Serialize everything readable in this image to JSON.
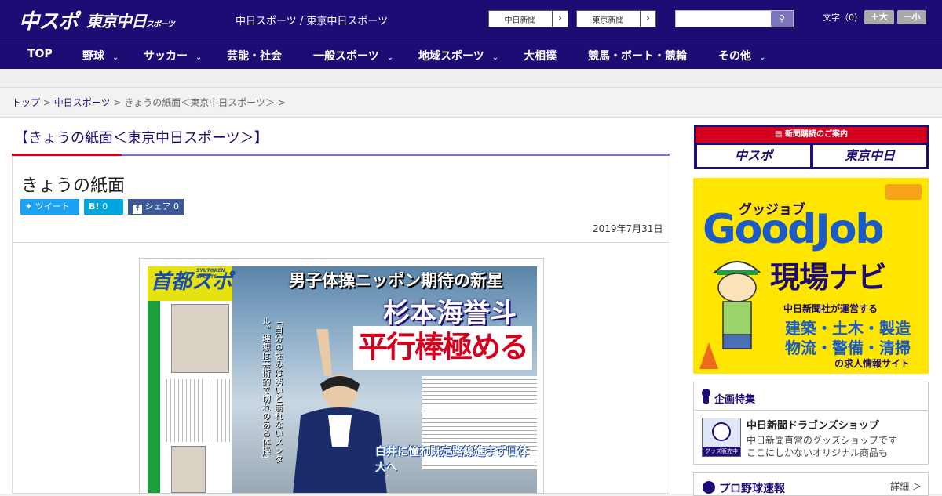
{
  "header": {
    "logo_chuspo": "中スポ",
    "logo_tokyo": "東京中日",
    "logo_tokyo_small": "スポーツ",
    "site_name": "中日スポーツ / 東京中日スポーツ",
    "newspaper_links": [
      {
        "label": "中日新聞"
      },
      {
        "label": "東京新聞"
      }
    ],
    "search": {
      "value": "",
      "placeholder": ""
    },
    "font_size": {
      "label": "文字（0）",
      "bigger": "＋大",
      "smaller": "－小"
    }
  },
  "nav": [
    {
      "label": "TOP"
    },
    {
      "label": "野球",
      "dropdown": true
    },
    {
      "label": "サッカー",
      "dropdown": true
    },
    {
      "label": "芸能・社会"
    },
    {
      "label": "一般スポーツ",
      "dropdown": true
    },
    {
      "label": "地域スポーツ",
      "dropdown": true
    },
    {
      "label": "大相撲"
    },
    {
      "label": "競馬・ボート・競輪"
    },
    {
      "label": "その他",
      "dropdown": true
    }
  ],
  "breadcrumb": {
    "top": "トップ",
    "chunichi": "中日スポーツ",
    "current": "きょうの紙面＜東京中日スポーツ＞",
    "sep": ">"
  },
  "section_heading": "【きょうの紙面＜東京中日スポーツ＞】",
  "page_title": "きょうの紙面",
  "share": {
    "tweet": "ツイート",
    "hatena": "B!",
    "hatena_count": "0",
    "facebook": "シェア",
    "facebook_count": "0"
  },
  "date": "2019年7月31日",
  "paper": {
    "brand": "首都スポ",
    "brand_sub": "SYUTOKEN SPORTS",
    "headline": "男子体操ニッポン期待の新星",
    "name": "杉本海誉斗",
    "banner": "平行棒極める",
    "quote": "「自分の強みは勢いと崩れないメンタル。理想は芸術的で切れのある体操」",
    "caption": "白井に憧れ既定路線進まず日体大へ"
  },
  "sidebar": {
    "subscribe_title": "新聞購読のご案内",
    "subscribe_chuspo": "中スポ",
    "subscribe_tokyo": "東京中日",
    "goodjob": {
      "top": "グッジョブ",
      "big": "GoodJob",
      "navi": "現場ナビ",
      "operator": "中日新聞社が運営する",
      "line1": "建築・土木・製造",
      "line2": "物流・警備・清掃",
      "site": "の求人情報サイト"
    },
    "feature": {
      "heading": "企画特集",
      "badge": "グッズ販売中",
      "title": "中日新聞ドラゴンズショップ",
      "desc1": "中日新聞直営のグッズショップです",
      "desc2": "ここにしかないオリジナル商品も"
    },
    "pro": {
      "heading": "プロ野球速報",
      "more": "詳細 ＞"
    }
  },
  "colors": {
    "brand": "#1e0b73",
    "accent": "#d4001e",
    "tweet": "#1da1f2",
    "hatena": "#00a4de",
    "facebook": "#3b5998",
    "goodjob_bg": "#ffe600"
  }
}
